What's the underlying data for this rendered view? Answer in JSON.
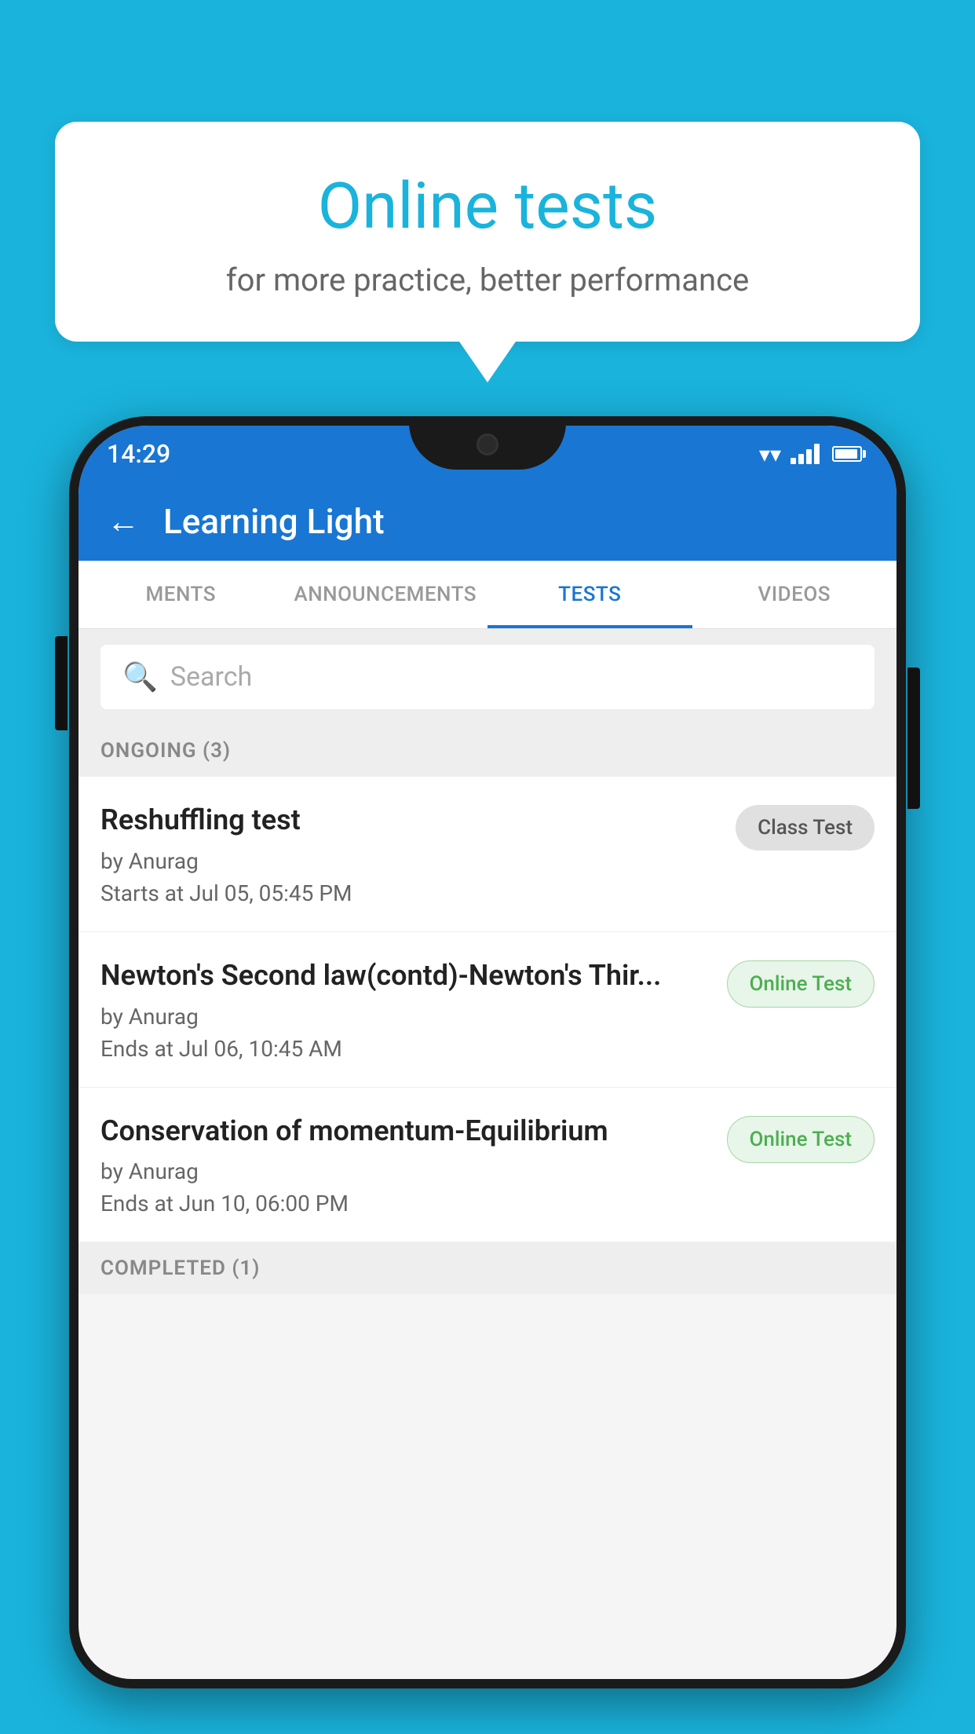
{
  "background_color": "#1ab3dc",
  "bubble": {
    "title": "Online tests",
    "subtitle": "for more practice, better performance"
  },
  "status_bar": {
    "time": "14:29",
    "wifi": "▼",
    "battery_level": 75
  },
  "app_header": {
    "title": "Learning Light",
    "back_label": "←"
  },
  "tabs": [
    {
      "label": "MENTS",
      "active": false
    },
    {
      "label": "ANNOUNCEMENTS",
      "active": false
    },
    {
      "label": "TESTS",
      "active": true
    },
    {
      "label": "VIDEOS",
      "active": false
    }
  ],
  "search": {
    "placeholder": "Search"
  },
  "sections": [
    {
      "label": "ONGOING (3)",
      "tests": [
        {
          "name": "Reshuffling test",
          "author": "by Anurag",
          "date": "Starts at  Jul 05, 05:45 PM",
          "badge": "Class Test",
          "badge_type": "class"
        },
        {
          "name": "Newton's Second law(contd)-Newton's Thir...",
          "author": "by Anurag",
          "date": "Ends at  Jul 06, 10:45 AM",
          "badge": "Online Test",
          "badge_type": "online"
        },
        {
          "name": "Conservation of momentum-Equilibrium",
          "author": "by Anurag",
          "date": "Ends at  Jun 10, 06:00 PM",
          "badge": "Online Test",
          "badge_type": "online"
        }
      ]
    }
  ],
  "completed_label": "COMPLETED (1)"
}
